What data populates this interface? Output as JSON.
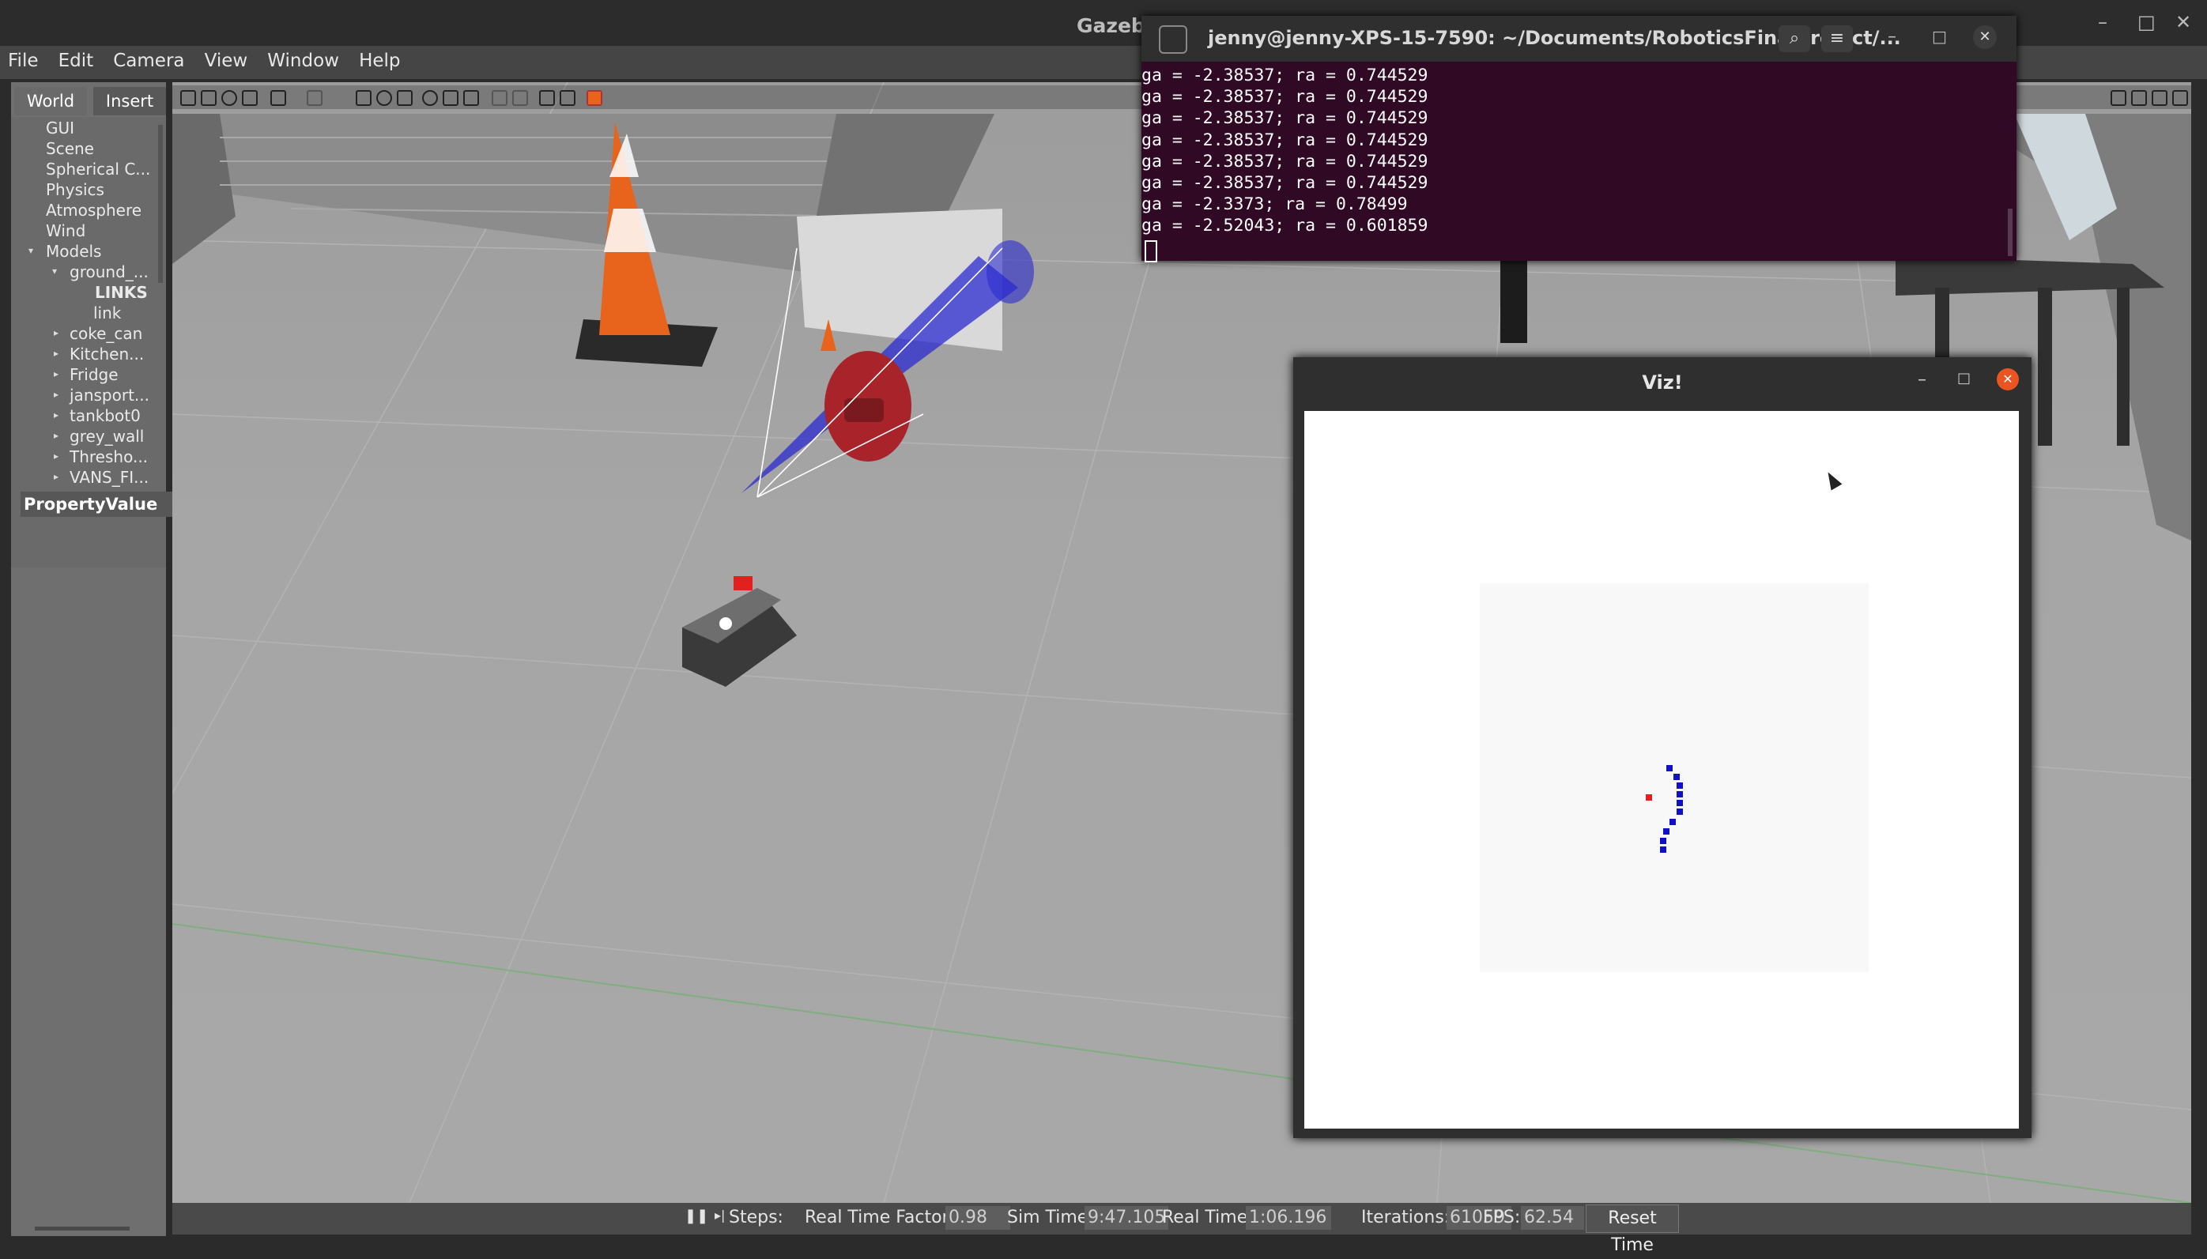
{
  "app": {
    "title": "Gazebo",
    "window_buttons": [
      "–",
      "□",
      "✕"
    ]
  },
  "menu": [
    "File",
    "Edit",
    "Camera",
    "View",
    "Window",
    "Help"
  ],
  "left_panel": {
    "tabs": [
      "World",
      "Insert"
    ],
    "tree": [
      "GUI",
      "Scene",
      "Spherical C...",
      "Physics",
      "Atmosphere",
      "Wind",
      "Models",
      "ground_...",
      "LINKS",
      "link",
      "coke_can",
      "Kitchen...",
      "Fridge",
      "jansport...",
      "tankbot0",
      "grey_wall",
      "Thresho...",
      "VANS_FI..."
    ],
    "property_header": "PropertyValue"
  },
  "terminal": {
    "title": "jenny@jenny-XPS-15-7590: ~/Documents/RoboticsFinalProject/...",
    "lines": [
      "ga = -2.38537; ra = 0.744529",
      "ga = -2.38537; ra = 0.744529",
      "ga = -2.38537; ra = 0.744529",
      "ga = -2.38537; ra = 0.744529",
      "ga = -2.38537; ra = 0.744529",
      "ga = -2.38537; ra = 0.744529",
      "ga = -2.3373; ra = 0.78499",
      "ga = -2.52043; ra = 0.601859"
    ]
  },
  "viz": {
    "title": "Viz!"
  },
  "statusbar": {
    "steps_label": "Steps:",
    "rtf_label": "Real Time Factor:",
    "rtf_value": "0.98",
    "sim_label": "Sim Time:",
    "sim_value": "9:47.105",
    "real_label": "Real Time:",
    "real_value": "1:06.196",
    "iter_label": "Iterations:",
    "iter_value": "61059",
    "fps_label": "FPS:",
    "fps_value": "62.54",
    "reset_label": "Reset Time"
  },
  "colors": {
    "terminal_bg": "#300a24",
    "close_button": "#e95420",
    "lidar_cone": "#2b2bd0",
    "cone_orange": "#e8641c"
  }
}
